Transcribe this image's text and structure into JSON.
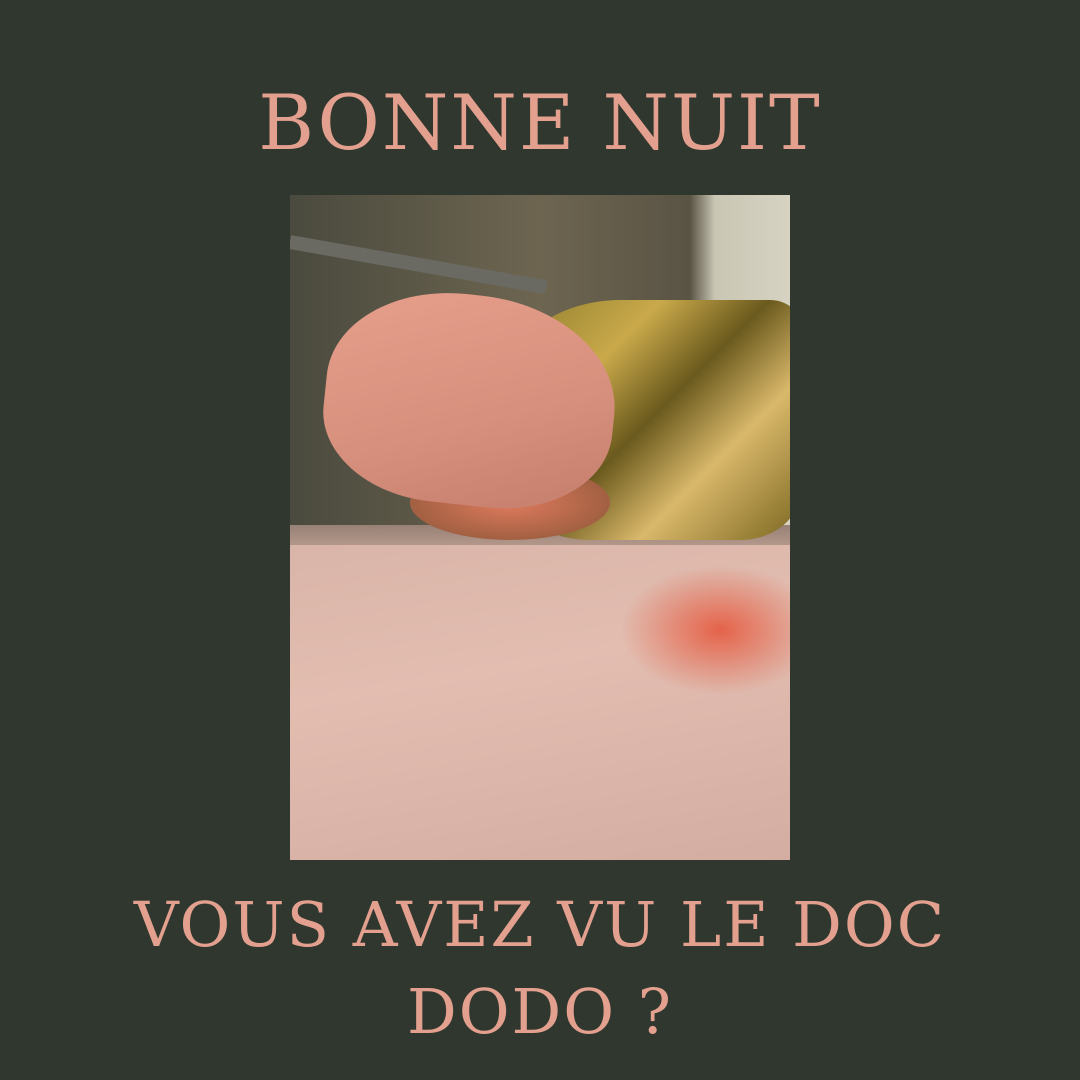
{
  "headline": "BONNE NUIT",
  "caption_line1": "VOUS AVEZ VU LE DOC",
  "caption_line2": "DODO ?",
  "colors": {
    "background": "#2f372e",
    "text": "#e3a08f"
  }
}
